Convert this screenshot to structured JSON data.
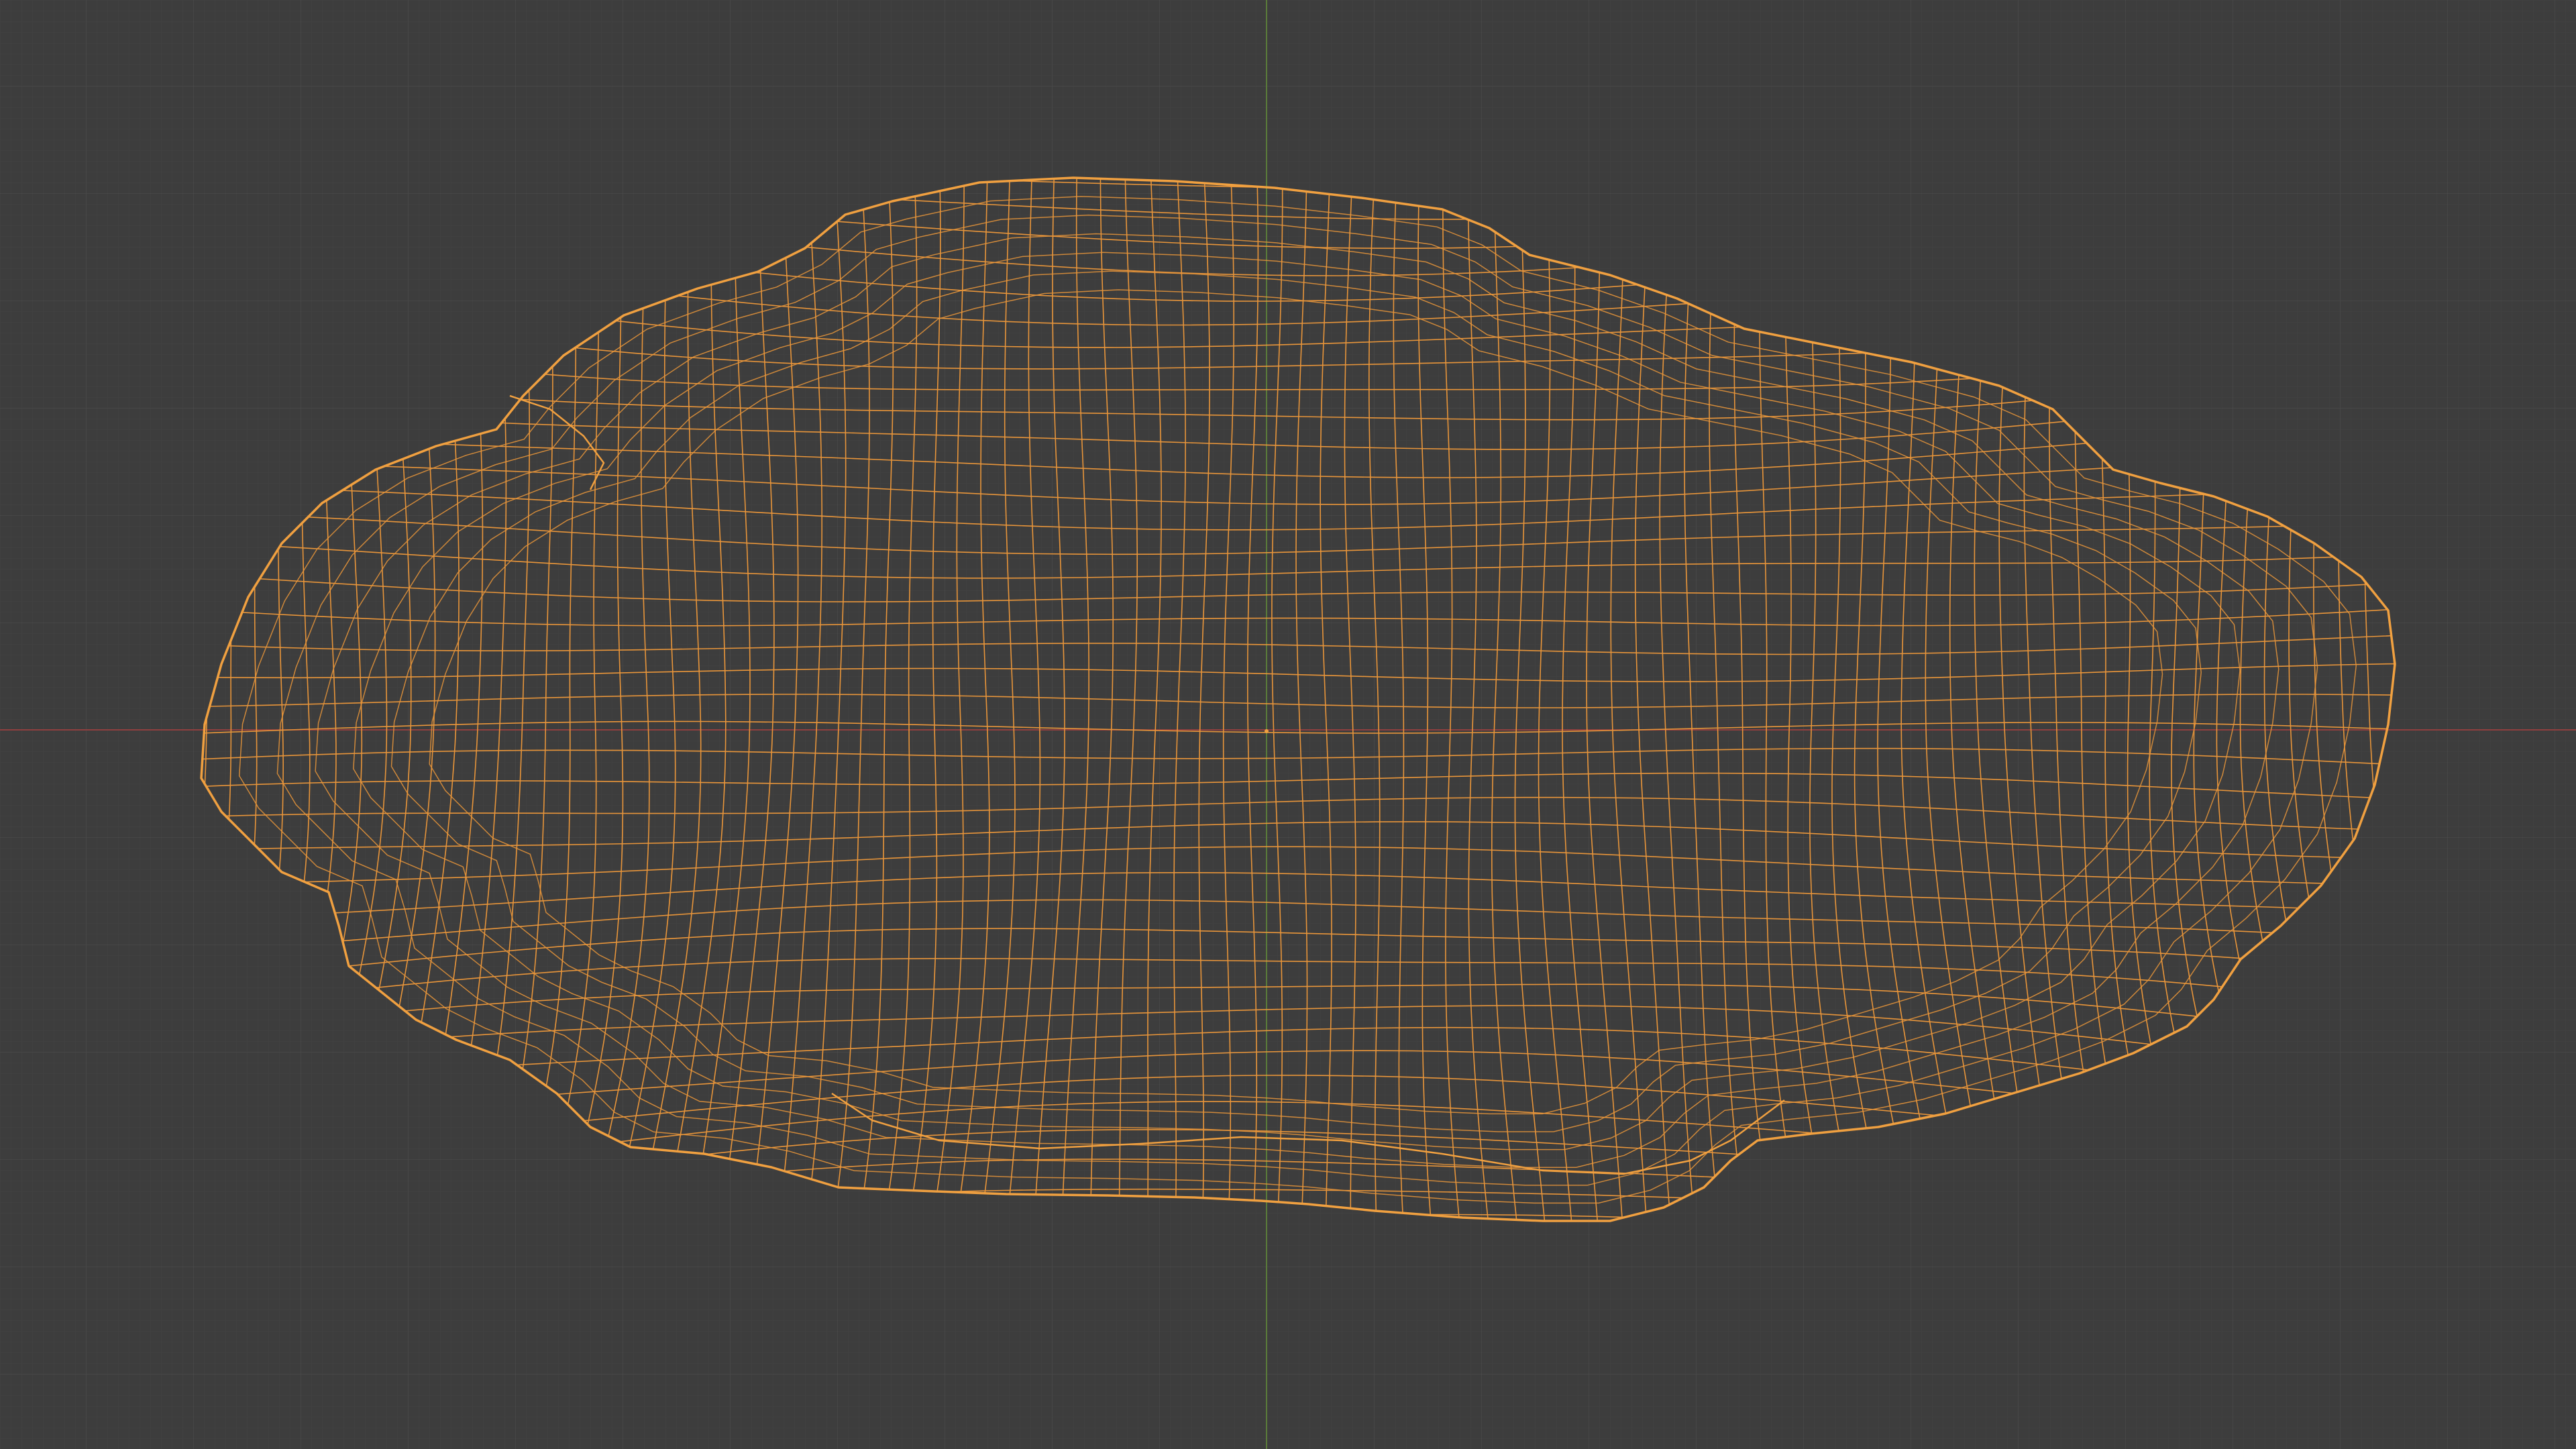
{
  "viewport": {
    "mode": "wireframe",
    "background_color": "#3d3d3d",
    "grid_minor_color": "#444444",
    "grid_major_color": "#4a4a4a",
    "x_axis_color": "#8f3f3f",
    "y_axis_color": "#5a7a3a",
    "wire_color": "#e8953a",
    "wire_edge_color": "#f0a040",
    "origin_marker_color": "#f0a040"
  },
  "mesh": {
    "selected": true,
    "shape": "rock"
  }
}
